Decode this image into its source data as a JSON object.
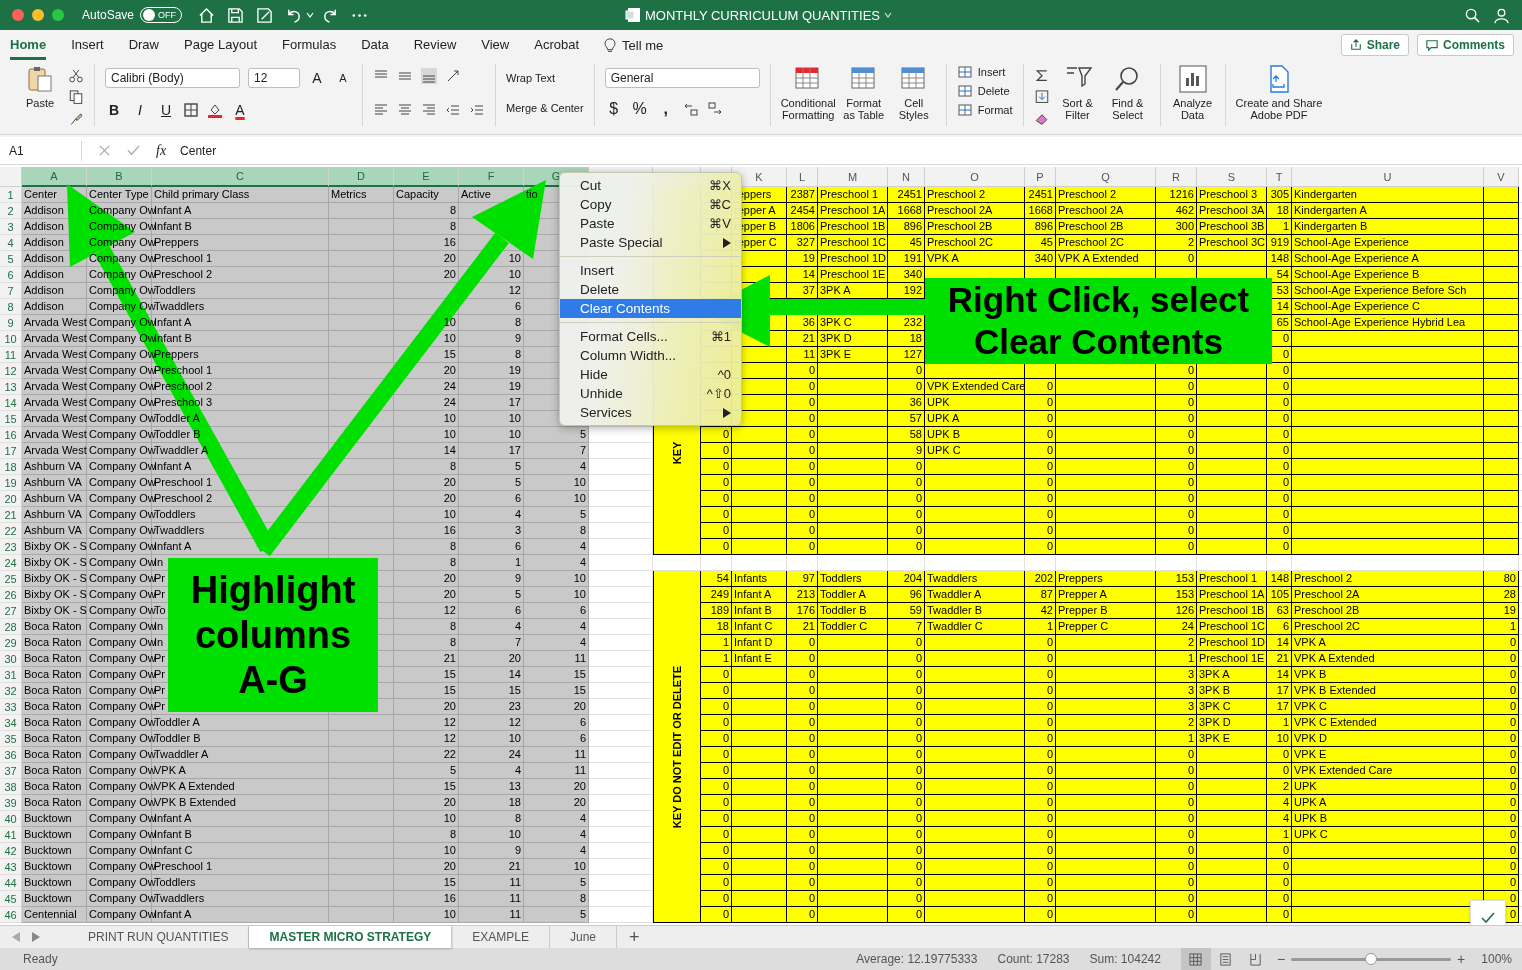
{
  "title_bar": {
    "autosave": "AutoSave",
    "autosave_toggle": {
      "label": "OFF",
      "on": false
    },
    "title": "MONTHLY CURRICULUM QUANTITIES"
  },
  "ribbon_tabs": [
    {
      "label": "Home",
      "selected": true
    },
    {
      "label": "Insert",
      "selected": false
    },
    {
      "label": "Draw",
      "selected": false
    },
    {
      "label": "Page Layout",
      "selected": false
    },
    {
      "label": "Formulas",
      "selected": false
    },
    {
      "label": "Data",
      "selected": false
    },
    {
      "label": "Review",
      "selected": false
    },
    {
      "label": "View",
      "selected": false
    },
    {
      "label": "Acrobat",
      "selected": false
    }
  ],
  "tell_me": "Tell me",
  "share": "Share",
  "comments": "Comments",
  "ribbon": {
    "paste": "Paste",
    "font": "Calibri (Body)",
    "size": "12",
    "grow": "A",
    "shrink": "A",
    "bold": "B",
    "italic": "I",
    "underline": "U",
    "font_color": "A",
    "wrap": "Wrap Text",
    "merge": "Merge & Center",
    "number_format": "General",
    "currency": "$",
    "percent": "%",
    "comma": ",",
    "styles": [
      [
        "Conditional",
        "Formatting"
      ],
      [
        "Format",
        "as Table"
      ],
      [
        "Cell",
        "Styles"
      ]
    ],
    "cells": [
      "Insert",
      "Delete",
      "Format"
    ],
    "editing": [
      [
        "Sort &",
        "Filter"
      ],
      [
        "Find &",
        "Select"
      ]
    ],
    "analyze": [
      "Analyze",
      "Data"
    ],
    "adobe": [
      "Create and Share",
      "Adobe PDF"
    ]
  },
  "formula_bar": {
    "name_box": "A1",
    "fx": "fx",
    "formula": "Center"
  },
  "sheet": {
    "columns": [
      {
        "letter": "A",
        "selected": true,
        "kind": "text"
      },
      {
        "letter": "B",
        "selected": true,
        "kind": "text"
      },
      {
        "letter": "C",
        "selected": true,
        "kind": "text"
      },
      {
        "letter": "D",
        "selected": true,
        "kind": "text"
      },
      {
        "letter": "E",
        "selected": true,
        "kind": "number"
      },
      {
        "letter": "F",
        "selected": true,
        "kind": "number"
      },
      {
        "letter": "G",
        "selected": true,
        "kind": "number"
      },
      {
        "selected": false,
        "kind": "text"
      },
      {
        "selected": false,
        "kind": "text",
        "key_area": true
      },
      {
        "selected": false,
        "kind": "number",
        "key_area": true
      },
      {
        "letter": "K",
        "selected": false,
        "kind": "text",
        "key_area": true
      },
      {
        "letter": "L",
        "selected": false,
        "kind": "number",
        "key_area": true
      },
      {
        "letter": "M",
        "selected": false,
        "kind": "text",
        "key_area": true
      },
      {
        "letter": "N",
        "selected": false,
        "kind": "number",
        "key_area": true
      },
      {
        "letter": "O",
        "selected": false,
        "kind": "text",
        "key_area": true
      },
      {
        "letter": "P",
        "selected": false,
        "kind": "number",
        "key_area": true
      },
      {
        "letter": "Q",
        "selected": false,
        "kind": "text",
        "key_area": true
      },
      {
        "letter": "R",
        "selected": false,
        "kind": "number",
        "key_area": true
      },
      {
        "letter": "S",
        "selected": false,
        "kind": "text",
        "key_area": true
      },
      {
        "letter": "T",
        "selected": false,
        "kind": "number",
        "key_area": true
      },
      {
        "letter": "U",
        "selected": false,
        "kind": "text",
        "key_area": true
      },
      {
        "letter": "V",
        "selected": false,
        "kind": "number",
        "key_area": true
      }
    ],
    "key_labels": [
      "KEY",
      "KEY DO NOT EDIT OR DELETE"
    ],
    "rows": [
      {
        "n": "1",
        "header": true,
        "key_area": true,
        "cells": {
          "A": "Center",
          "B": "Center Type",
          "C": "Child primary Class",
          "D": "Metrics",
          "E": "Capacity",
          "F": "Active",
          "G": "tio",
          "K": "reppers",
          "L": "2387",
          "M": "Preschool 1",
          "N": "2451",
          "O": "Preschool 2",
          "P": "2451",
          "Q": "Preschool 2",
          "R": "1216",
          "S": "Preschool 3",
          "T": "305",
          "U": "Kindergarten"
        }
      },
      {
        "n": "2",
        "key_area": true,
        "cells": {
          "A": "Addison",
          "B": "Company Ow",
          "C": "Infant A",
          "E": "8",
          "K": "repper A",
          "L": "2454",
          "M": "Preschool 1A",
          "N": "1668",
          "O": "Preschool 2A",
          "P": "1668",
          "Q": "Preschool 2A",
          "R": "462",
          "S": "Preschool 3A",
          "T": "18",
          "U": "Kindergarten A"
        }
      },
      {
        "n": "3",
        "key_area": true,
        "cells": {
          "A": "Addison",
          "B": "Company Ow",
          "C": "Infant B",
          "E": "8",
          "K": "repper B",
          "L": "1806",
          "M": "Preschool 1B",
          "N": "896",
          "O": "Preschool 2B",
          "P": "896",
          "Q": "Preschool 2B",
          "R": "300",
          "S": "Preschool 3B",
          "T": "1",
          "U": "Kindergarten B"
        }
      },
      {
        "n": "4",
        "key_area": true,
        "cells": {
          "A": "Addison",
          "B": "Company Ow",
          "C": "Preppers",
          "E": "16",
          "K": "repper C",
          "L": "327",
          "M": "Preschool 1C",
          "N": "45",
          "O": "Preschool 2C",
          "P": "45",
          "Q": "Preschool 2C",
          "R": "2",
          "S": "Preschool 3C",
          "T": "919",
          "U": "School-Age Experience"
        }
      },
      {
        "n": "5",
        "key_area": true,
        "cells": {
          "A": "Addison",
          "B": "Company Ow",
          "C": "Preschool 1",
          "E": "20",
          "F": "10",
          "L": "19",
          "M": "Preschool 1D",
          "N": "191",
          "O": "VPK A",
          "P": "340",
          "Q": "VPK A Extended",
          "R": "0",
          "T": "148",
          "U": "School-Age Experience A"
        }
      },
      {
        "n": "6",
        "key_area": true,
        "cells": {
          "A": "Addison",
          "B": "Company Ow",
          "C": "Preschool 2",
          "E": "20",
          "F": "10",
          "L": "14",
          "M": "Preschool 1E",
          "N": "340",
          "T": "54",
          "U": "School-Age Experience B"
        }
      },
      {
        "n": "7",
        "key_area": true,
        "cells": {
          "A": "Addison",
          "B": "Company Ow",
          "C": "Toddlers",
          "F": "12",
          "L": "37",
          "M": "3PK A",
          "N": "192",
          "T": "53",
          "U": "School-Age Experience Before Sch"
        }
      },
      {
        "n": "8",
        "key_area": true,
        "cells": {
          "A": "Addison",
          "B": "Company Ow",
          "C": "Twaddlers",
          "F": "6",
          "T": "14",
          "U": "School-Age Experience C"
        }
      },
      {
        "n": "9",
        "key_area": true,
        "cells": {
          "A": "Arvada West",
          "B": "Company Ow",
          "C": "Infant A",
          "E": "10",
          "F": "8",
          "L": "36",
          "M": "3PK C",
          "N": "232",
          "T": "65",
          "U": "School-Age Experience Hybrid Lea"
        }
      },
      {
        "n": "10",
        "key_area": true,
        "cells": {
          "A": "Arvada West",
          "B": "Company Ow",
          "C": "Infant B",
          "E": "10",
          "F": "9",
          "L": "21",
          "M": "3PK D",
          "N": "18",
          "T": "0"
        }
      },
      {
        "n": "11",
        "key_area": true,
        "cells": {
          "A": "Arvada West",
          "B": "Company Ow",
          "C": "Preppers",
          "E": "15",
          "F": "8",
          "L": "11",
          "M": "3PK E",
          "N": "127",
          "T": "0"
        }
      },
      {
        "n": "12",
        "key_area": true,
        "cells": {
          "A": "Arvada West",
          "B": "Company Ow",
          "C": "Preschool 1",
          "E": "20",
          "F": "19",
          "L": "0",
          "N": "0",
          "R": "0",
          "T": "0"
        }
      },
      {
        "n": "13",
        "key_area": true,
        "cells": {
          "A": "Arvada West",
          "B": "Company Ow",
          "C": "Preschool 2",
          "E": "24",
          "F": "19",
          "L": "0",
          "N": "0",
          "O": "VPK Extended Care",
          "P": "0",
          "R": "0",
          "T": "0"
        }
      },
      {
        "n": "14",
        "key_area": true,
        "cells": {
          "A": "Arvada West",
          "B": "Company Ow",
          "C": "Preschool 3",
          "E": "24",
          "F": "17",
          "L": "0",
          "N": "36",
          "O": "UPK",
          "P": "0",
          "R": "0",
          "T": "0"
        }
      },
      {
        "n": "15",
        "key_area": true,
        "cells": {
          "A": "Arvada West",
          "B": "Company Ow",
          "C": "Toddler A",
          "E": "10",
          "F": "10",
          "L": "0",
          "N": "57",
          "O": "UPK A",
          "P": "0",
          "R": "0",
          "T": "0"
        }
      },
      {
        "n": "16",
        "key_area": true,
        "cells": {
          "A": "Arvada West",
          "B": "Company Ow",
          "C": "Toddler B",
          "E": "10",
          "F": "10",
          "G": "5",
          "J": "0",
          "L": "0",
          "N": "58",
          "O": "UPK B",
          "P": "0",
          "R": "0",
          "T": "0"
        }
      },
      {
        "n": "17",
        "key_area": true,
        "cells": {
          "A": "Arvada West",
          "B": "Company Ow",
          "C": "Twaddler A",
          "E": "14",
          "F": "17",
          "G": "7",
          "J": "0",
          "L": "0",
          "N": "9",
          "O": "UPK C",
          "P": "0",
          "R": "0",
          "T": "0"
        }
      },
      {
        "n": "18",
        "key_area": true,
        "cells": {
          "A": "Ashburn VA",
          "B": "Company Ow",
          "C": "Infant A",
          "E": "8",
          "F": "5",
          "G": "4",
          "J": "0",
          "L": "0",
          "N": "0",
          "P": "0",
          "R": "0",
          "T": "0"
        }
      },
      {
        "n": "19",
        "key_area": true,
        "cells": {
          "A": "Ashburn VA",
          "B": "Company Ow",
          "C": "Preschool 1",
          "E": "20",
          "F": "5",
          "G": "10",
          "J": "0",
          "L": "0",
          "N": "0",
          "P": "0",
          "R": "0",
          "T": "0"
        }
      },
      {
        "n": "20",
        "key_area": true,
        "cells": {
          "A": "Ashburn VA",
          "B": "Company Ow",
          "C": "Preschool 2",
          "E": "20",
          "F": "6",
          "G": "10",
          "J": "0",
          "L": "0",
          "N": "0",
          "P": "0",
          "R": "0",
          "T": "0"
        }
      },
      {
        "n": "21",
        "key_area": true,
        "cells": {
          "A": "Ashburn VA",
          "B": "Company Ow",
          "C": "Toddlers",
          "E": "10",
          "F": "4",
          "G": "5",
          "J": "0",
          "L": "0",
          "N": "0",
          "P": "0",
          "R": "0",
          "T": "0"
        }
      },
      {
        "n": "22",
        "key_area": true,
        "cells": {
          "A": "Ashburn VA",
          "B": "Company Ow",
          "C": "Twaddlers",
          "E": "16",
          "F": "3",
          "G": "8",
          "J": "0",
          "L": "0",
          "N": "0",
          "P": "0",
          "R": "0",
          "T": "0"
        }
      },
      {
        "n": "23",
        "key_area": true,
        "cells": {
          "A": "Bixby OK - S",
          "B": "Company Ow",
          "C": "Infant A",
          "E": "8",
          "F": "6",
          "G": "4",
          "J": "0",
          "L": "0",
          "N": "0",
          "P": "0",
          "R": "0",
          "T": "0"
        }
      },
      {
        "n": "24",
        "key_area": false,
        "cells": {
          "A": "Bixby OK - S",
          "B": "Company Ow",
          "C": "In",
          "E": "8",
          "F": "1",
          "G": "4"
        }
      },
      {
        "n": "25",
        "key_area": true,
        "cells": {
          "A": "Bixby OK - S",
          "B": "Company Ow",
          "C": "Pr",
          "E": "20",
          "F": "9",
          "G": "10",
          "J": "54",
          "K": "Infants",
          "L": "97",
          "M": "Toddlers",
          "N": "204",
          "O": "Twaddlers",
          "P": "202",
          "Q": "Preppers",
          "R": "153",
          "S": "Preschool 1",
          "T": "148",
          "U": "Preschool 2",
          "V": "80"
        }
      },
      {
        "n": "26",
        "key_area": true,
        "cells": {
          "A": "Bixby OK - S",
          "B": "Company Ow",
          "C": "Pr",
          "E": "20",
          "F": "5",
          "G": "10",
          "J": "249",
          "K": "Infant A",
          "L": "213",
          "M": "Toddler A",
          "N": "96",
          "O": "Twaddler A",
          "P": "87",
          "Q": "Prepper A",
          "R": "153",
          "S": "Preschool 1A",
          "T": "105",
          "U": "Preschool 2A",
          "V": "28"
        }
      },
      {
        "n": "27",
        "key_area": true,
        "cells": {
          "A": "Bixby OK - S",
          "B": "Company Ow",
          "C": "To",
          "E": "12",
          "F": "6",
          "G": "6",
          "J": "189",
          "K": "Infant B",
          "L": "176",
          "M": "Toddler B",
          "N": "59",
          "O": "Twaddler B",
          "P": "42",
          "Q": "Prepper B",
          "R": "126",
          "S": "Preschool 1B",
          "T": "63",
          "U": "Preschool 2B",
          "V": "19"
        }
      },
      {
        "n": "28",
        "key_area": true,
        "cells": {
          "A": "Boca Raton",
          "B": "Company Ow",
          "C": "In",
          "E": "8",
          "F": "4",
          "G": "4",
          "J": "18",
          "K": "Infant C",
          "L": "21",
          "M": "Toddler C",
          "N": "7",
          "O": "Twaddler C",
          "P": "1",
          "Q": "Prepper C",
          "R": "24",
          "S": "Preschool 1C",
          "T": "6",
          "U": "Preschool 2C",
          "V": "1"
        }
      },
      {
        "n": "29",
        "key_area": true,
        "cells": {
          "A": "Boca Raton",
          "B": "Company Ow",
          "C": "In",
          "E": "8",
          "F": "7",
          "G": "4",
          "J": "1",
          "K": "Infant D",
          "L": "0",
          "N": "0",
          "P": "0",
          "R": "2",
          "S": "Preschool 1D",
          "T": "14",
          "U": "VPK A",
          "V": "0"
        }
      },
      {
        "n": "30",
        "key_area": true,
        "cells": {
          "A": "Boca Raton",
          "B": "Company Ow",
          "C": "Pr",
          "E": "21",
          "F": "20",
          "G": "11",
          "J": "1",
          "K": "Infant E",
          "L": "0",
          "N": "0",
          "P": "0",
          "R": "1",
          "S": "Preschool 1E",
          "T": "21",
          "U": "VPK A Extended",
          "V": "0"
        }
      },
      {
        "n": "31",
        "key_area": true,
        "cells": {
          "A": "Boca Raton",
          "B": "Company Ow",
          "C": "Pr",
          "E": "15",
          "F": "14",
          "G": "15",
          "J": "0",
          "L": "0",
          "N": "0",
          "P": "0",
          "R": "3",
          "S": "3PK A",
          "T": "14",
          "U": "VPK B",
          "V": "0"
        }
      },
      {
        "n": "32",
        "key_area": true,
        "cells": {
          "A": "Boca Raton",
          "B": "Company Ow",
          "C": "Pr",
          "E": "15",
          "F": "15",
          "G": "15",
          "J": "0",
          "L": "0",
          "N": "0",
          "P": "0",
          "R": "3",
          "S": "3PK B",
          "T": "17",
          "U": "VPK B Extended",
          "V": "0"
        }
      },
      {
        "n": "33",
        "key_area": true,
        "cells": {
          "A": "Boca Raton",
          "B": "Company Ow",
          "C": "Pr",
          "E": "20",
          "F": "23",
          "G": "20",
          "J": "0",
          "L": "0",
          "N": "0",
          "P": "0",
          "R": "3",
          "S": "3PK C",
          "T": "17",
          "U": "VPK C",
          "V": "0"
        }
      },
      {
        "n": "34",
        "key_area": true,
        "cells": {
          "A": "Boca Raton",
          "B": "Company Ow",
          "C": "Toddler A",
          "E": "12",
          "F": "12",
          "G": "6",
          "J": "0",
          "L": "0",
          "N": "0",
          "P": "0",
          "R": "2",
          "S": "3PK D",
          "T": "1",
          "U": "VPK C Extended",
          "V": "0"
        }
      },
      {
        "n": "35",
        "key_area": true,
        "cells": {
          "A": "Boca Raton",
          "B": "Company Ow",
          "C": "Toddler B",
          "E": "12",
          "F": "10",
          "G": "6",
          "J": "0",
          "L": "0",
          "N": "0",
          "P": "0",
          "R": "1",
          "S": "3PK E",
          "T": "10",
          "U": "VPK D",
          "V": "0"
        }
      },
      {
        "n": "36",
        "key_area": true,
        "cells": {
          "A": "Boca Raton",
          "B": "Company Ow",
          "C": "Twaddler A",
          "E": "22",
          "F": "24",
          "G": "11",
          "J": "0",
          "L": "0",
          "N": "0",
          "P": "0",
          "R": "0",
          "T": "0",
          "U": "VPK E",
          "V": "0"
        }
      },
      {
        "n": "37",
        "key_area": true,
        "cells": {
          "A": "Boca Raton",
          "B": "Company Ow",
          "C": "VPK A",
          "E": "5",
          "F": "4",
          "G": "11",
          "J": "0",
          "L": "0",
          "N": "0",
          "P": "0",
          "R": "0",
          "T": "0",
          "U": "VPK Extended Care",
          "V": "0"
        }
      },
      {
        "n": "38",
        "key_area": true,
        "cells": {
          "A": "Boca Raton",
          "B": "Company Ow",
          "C": "VPK A Extended",
          "E": "15",
          "F": "13",
          "G": "20",
          "J": "0",
          "L": "0",
          "N": "0",
          "P": "0",
          "R": "0",
          "T": "2",
          "U": "UPK",
          "V": "0"
        }
      },
      {
        "n": "39",
        "key_area": true,
        "cells": {
          "A": "Boca Raton",
          "B": "Company Ow",
          "C": "VPK B Extended",
          "E": "20",
          "F": "18",
          "G": "20",
          "J": "0",
          "L": "0",
          "N": "0",
          "P": "0",
          "R": "0",
          "T": "4",
          "U": "UPK A",
          "V": "0"
        }
      },
      {
        "n": "40",
        "key_area": true,
        "cells": {
          "A": "Bucktown",
          "B": "Company Ow",
          "C": "Infant A",
          "E": "10",
          "F": "8",
          "G": "4",
          "J": "0",
          "L": "0",
          "N": "0",
          "P": "0",
          "R": "0",
          "T": "4",
          "U": "UPK B",
          "V": "0"
        }
      },
      {
        "n": "41",
        "key_area": true,
        "cells": {
          "A": "Bucktown",
          "B": "Company Ow",
          "C": "Infant B",
          "E": "8",
          "F": "10",
          "G": "4",
          "J": "0",
          "L": "0",
          "N": "0",
          "P": "0",
          "R": "0",
          "T": "1",
          "U": "UPK C",
          "V": "0"
        }
      },
      {
        "n": "42",
        "key_area": true,
        "cells": {
          "A": "Bucktown",
          "B": "Company Ow",
          "C": "Infant C",
          "E": "10",
          "F": "9",
          "G": "4",
          "J": "0",
          "L": "0",
          "N": "0",
          "P": "0",
          "R": "0",
          "T": "0",
          "V": "0"
        }
      },
      {
        "n": "43",
        "key_area": true,
        "cells": {
          "A": "Bucktown",
          "B": "Company Ow",
          "C": "Preschool 1",
          "E": "20",
          "F": "21",
          "G": "10",
          "J": "0",
          "L": "0",
          "N": "0",
          "P": "0",
          "R": "0",
          "T": "0",
          "V": "0"
        }
      },
      {
        "n": "44",
        "key_area": true,
        "cells": {
          "A": "Bucktown",
          "B": "Company Ow",
          "C": "Toddlers",
          "E": "15",
          "F": "11",
          "G": "5",
          "J": "0",
          "L": "0",
          "N": "0",
          "P": "0",
          "R": "0",
          "T": "0",
          "V": "0"
        }
      },
      {
        "n": "45",
        "key_area": true,
        "cells": {
          "A": "Bucktown",
          "B": "Company Ow",
          "C": "Twaddlers",
          "E": "16",
          "F": "11",
          "G": "8",
          "J": "0",
          "L": "0",
          "N": "0",
          "P": "0",
          "R": "0",
          "T": "0",
          "V": "0"
        }
      },
      {
        "n": "46",
        "key_area": true,
        "cells": {
          "A": "Centennial",
          "B": "Company Ow",
          "C": "Infant A",
          "E": "10",
          "F": "11",
          "G": "5",
          "J": "0",
          "L": "0",
          "N": "0",
          "P": "0",
          "R": "0",
          "T": "0",
          "V": "0"
        }
      }
    ]
  },
  "context_menu": {
    "items": [
      {
        "kind": "item",
        "label": "Cut",
        "shortcut": "⌘X",
        "submenu": false,
        "selected": false
      },
      {
        "kind": "item",
        "label": "Copy",
        "shortcut": "⌘C",
        "submenu": false,
        "selected": false
      },
      {
        "kind": "item",
        "label": "Paste",
        "shortcut": "⌘V",
        "submenu": false,
        "selected": false
      },
      {
        "kind": "item",
        "label": "Paste Special",
        "submenu": true,
        "selected": false
      },
      {
        "kind": "separator"
      },
      {
        "kind": "item",
        "label": "Insert",
        "submenu": false,
        "selected": false
      },
      {
        "kind": "item",
        "label": "Delete",
        "submenu": false,
        "selected": false
      },
      {
        "kind": "item",
        "label": "Clear Contents",
        "submenu": false,
        "selected": true
      },
      {
        "kind": "separator"
      },
      {
        "kind": "item",
        "label": "Format Cells...",
        "shortcut": "⌘1",
        "submenu": false,
        "selected": false
      },
      {
        "kind": "item",
        "label": "Column Width...",
        "submenu": false,
        "selected": false
      },
      {
        "kind": "item",
        "label": "Hide",
        "shortcut": "^0",
        "submenu": false,
        "selected": false
      },
      {
        "kind": "item",
        "label": "Unhide",
        "shortcut": "^⇧0",
        "submenu": false,
        "selected": false
      },
      {
        "kind": "item",
        "label": "Services",
        "submenu": true,
        "selected": false
      }
    ]
  },
  "callouts": [
    {
      "kind": "highlight",
      "lines": [
        "Highlight",
        "columns",
        "A-G"
      ]
    },
    {
      "kind": "right_click",
      "lines": [
        "Right Click, select",
        "Clear Contents"
      ]
    }
  ],
  "sheet_tabs": [
    {
      "label": "PRINT RUN QUANTITIES",
      "selected": false
    },
    {
      "label": "MASTER MICRO STRATEGY",
      "selected": true
    },
    {
      "label": "EXAMPLE",
      "selected": false
    },
    {
      "label": "June",
      "selected": false
    }
  ],
  "add_sheet": "+",
  "status_bar": {
    "status": "Ready",
    "average": "Average: 12.19775333",
    "count": "Count: 17283",
    "sum": "Sum: 104242",
    "zoom_out": "−",
    "zoom_in": "+",
    "zoom": {
      "level": 0.5
    },
    "zoom_label": "100%"
  }
}
